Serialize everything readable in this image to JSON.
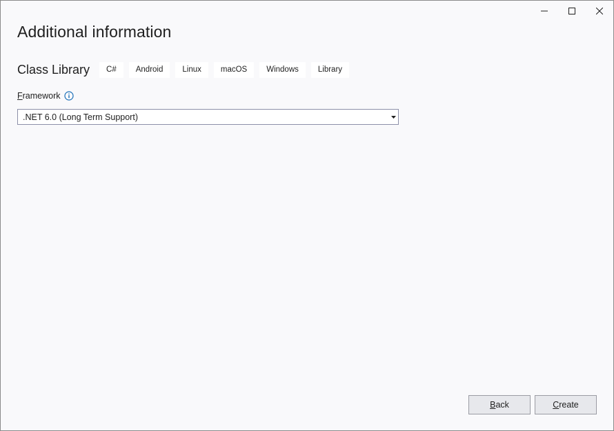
{
  "window": {
    "minimize_icon": "minimize-icon",
    "maximize_icon": "maximize-icon",
    "close_icon": "close-icon"
  },
  "page": {
    "title": "Additional information"
  },
  "template": {
    "name": "Class Library",
    "tags": [
      "C#",
      "Android",
      "Linux",
      "macOS",
      "Windows",
      "Library"
    ]
  },
  "framework": {
    "label_accel": "F",
    "label_rest": "ramework",
    "info_icon": "info-icon",
    "selected_value": ".NET 6.0 (Long Term Support)",
    "dropdown_icon": "chevron-down-icon"
  },
  "buttons": {
    "back_accel": "B",
    "back_rest": "ack",
    "create_accel": "C",
    "create_rest": "reate"
  },
  "colors": {
    "background": "#f9f9fb",
    "tag_background": "#ffffff",
    "button_background": "#e7e8ec",
    "info_icon": "#1a6fb8"
  }
}
